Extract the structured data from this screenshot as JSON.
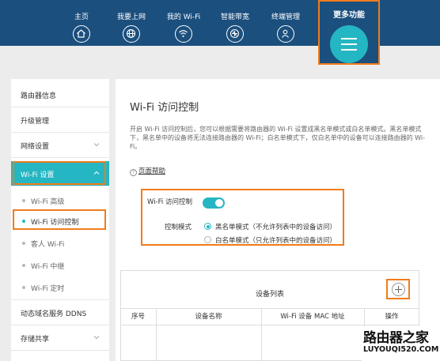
{
  "nav": {
    "items": [
      {
        "label": "主页",
        "icon": "home-icon"
      },
      {
        "label": "我要上网",
        "icon": "globe-icon"
      },
      {
        "label": "我的 Wi-Fi",
        "icon": "wifi-icon"
      },
      {
        "label": "智能带宽",
        "icon": "bandwidth-icon"
      },
      {
        "label": "终端管理",
        "icon": "user-icon"
      }
    ],
    "more_label": "更多功能",
    "more_icon": "menu-icon"
  },
  "sidebar": {
    "items": [
      {
        "label": "路由器信息"
      },
      {
        "label": "升级管理"
      },
      {
        "label": "网络设置"
      },
      {
        "label": "Wi-Fi 设置"
      }
    ],
    "sub_items": [
      {
        "label": "Wi-Fi 高级"
      },
      {
        "label": "Wi-Fi 访问控制"
      },
      {
        "label": "客人 Wi-Fi"
      },
      {
        "label": "Wi-Fi 中继"
      },
      {
        "label": "Wi-Fi 定时"
      }
    ],
    "bottom_items": [
      {
        "label": "动态域名服务 DDNS"
      },
      {
        "label": "存储共享"
      }
    ]
  },
  "main": {
    "title": "Wi-Fi 访问控制",
    "description": "开启 Wi-Fi 访问控制后，您可以根据需要将路由器的 Wi-Fi 设置成黑名单模式或白名单模式。黑名单模式下，黑名单中的设备将无法连接路由器的 Wi-Fi；白名单模式下，仅白名单中的设备可以连接路由器的 Wi-Fi。",
    "help_link": "页面帮助",
    "control": {
      "toggle_label": "Wi-Fi 访问控制",
      "toggle_on": true,
      "mode_label": "控制模式",
      "options": [
        {
          "label": "黑名单模式（不允许列表中的设备访问）",
          "selected": true
        },
        {
          "label": "白名单模式（只允许列表中的设备访问）",
          "selected": false
        }
      ]
    },
    "device_list": {
      "title": "设备列表",
      "columns": [
        "序号",
        "设备名称",
        "Wi-Fi 设备 MAC 地址",
        "操作"
      ]
    }
  },
  "watermark": {
    "name": "路由器之家",
    "url": "LUYOUQI520.COM"
  },
  "colors": {
    "nav_bg": "#1b4f7e",
    "accent": "#24b6c3",
    "highlight": "#f07c1b"
  }
}
